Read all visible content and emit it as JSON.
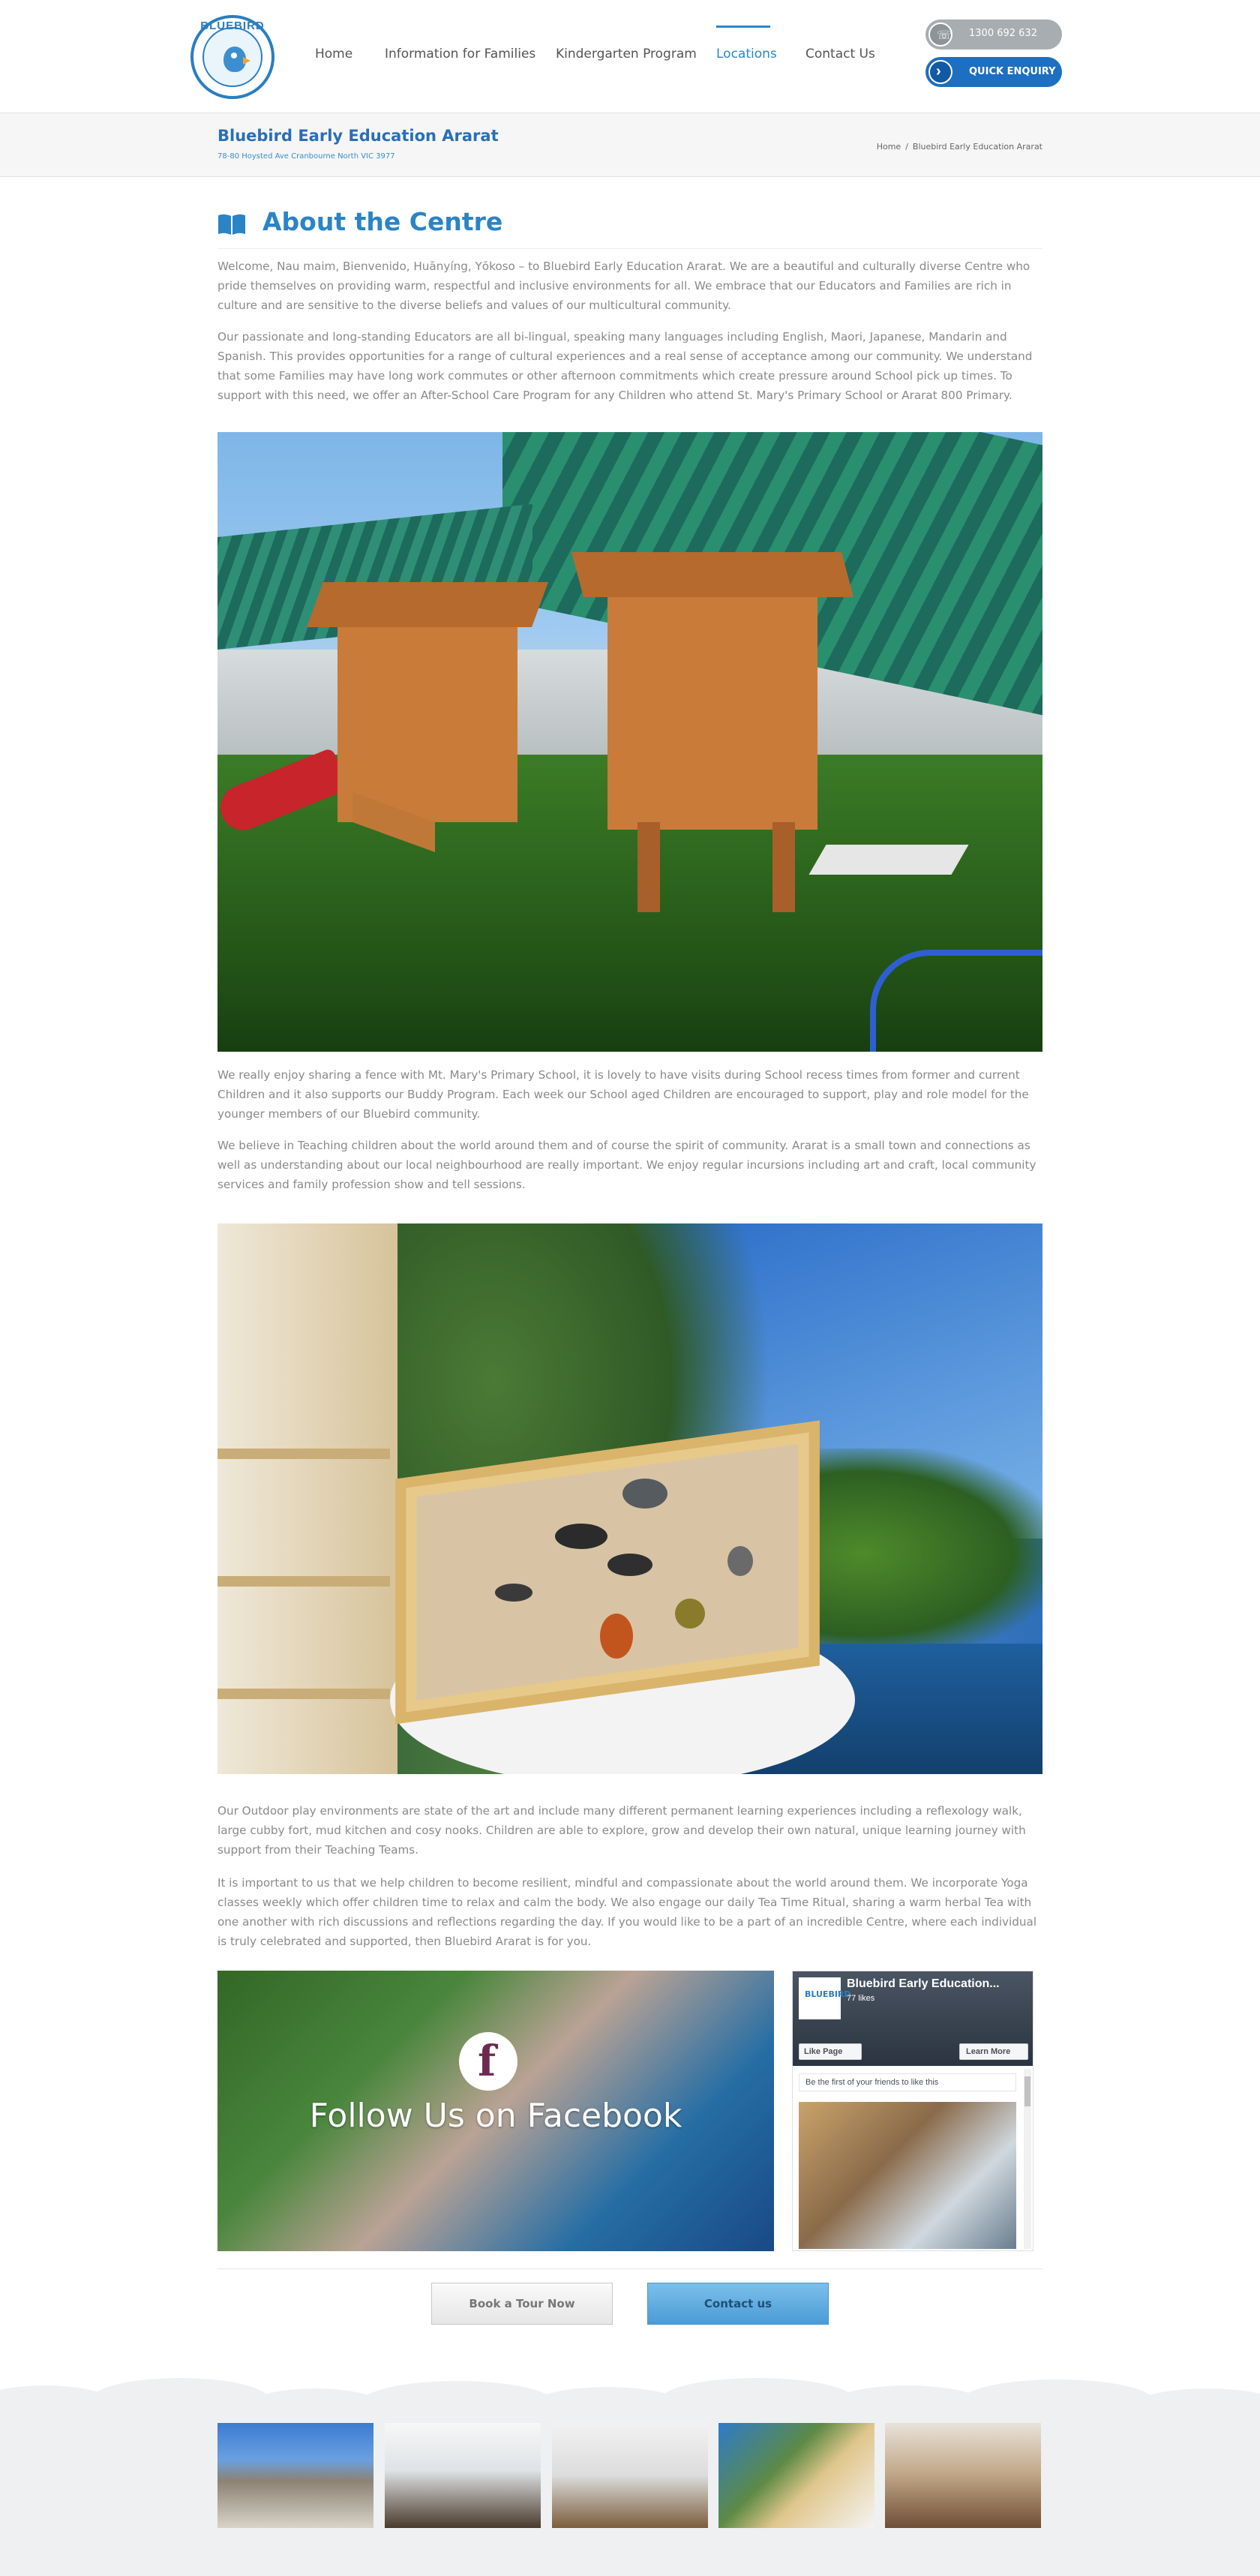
{
  "brand": {
    "logo_text": "BLUEBIRD",
    "primary_color": "#2a84c6",
    "accent_color": "#1d6fc1"
  },
  "nav": {
    "items": [
      {
        "label": "Home",
        "active": false
      },
      {
        "label": "Information for Families",
        "active": false
      },
      {
        "label": "Kindergarten Program",
        "active": false
      },
      {
        "label": "Locations",
        "active": true
      },
      {
        "label": "Contact Us",
        "active": false
      }
    ]
  },
  "header": {
    "phone": "1300 692 632",
    "quick_enquiry": "QUICK ENQUIRY",
    "phone_icon": "phone-icon",
    "enquiry_icon": "chevron-right-icon"
  },
  "titlebar": {
    "title": "Bluebird Early Education Ararat",
    "address": "78-80 Hoysted Ave Cranbourne North VIC 3977",
    "breadcrumb": [
      "Home",
      "Bluebird Early Education Ararat"
    ],
    "breadcrumb_sep": "/"
  },
  "about": {
    "heading": "About the Centre",
    "heading_icon": "book-icon",
    "paragraphs": [
      "Welcome, Nau maim, Bienvenido, Huānyíng, Yōkoso – to Bluebird Early Education Ararat. We are a beautiful and culturally diverse Centre who pride themselves on providing warm, respectful and inclusive environments for all. We embrace that our Educators and Families are rich in culture and are sensitive to the diverse beliefs and values of our multicultural community.",
      "Our passionate and long-standing Educators are all bi-lingual, speaking many languages including English, Maori, Japanese, Mandarin and Spanish. This provides opportunities for a range of cultural experiences and a real sense of acceptance among our community. We understand that some Families may have long work commutes or other afternoon commitments which create pressure around School pick up times. To support with this need, we offer an After-School Care Program for any Children who attend St. Mary's Primary School or Ararat 800 Primary.",
      "We really enjoy sharing a fence with Mt. Mary's Primary School, it is lovely to have visits during School recess times from former and current Children and it also supports our Buddy Program. Each week our School aged Children are encouraged to support, play and role model for the younger members of our Bluebird community.",
      "We believe in Teaching children about the world around them and of course the spirit of community. Ararat is a small town and connections as well as understanding about our local neighbourhood are really important. We enjoy regular incursions including art and craft, local community services and family profession show and tell sessions.",
      "Our Outdoor play environments are state of the art and include many different permanent learning experiences including a reflexology walk, large cubby fort, mud kitchen and cosy nooks. Children are able to explore, grow and develop their own natural, unique learning journey with support from their Teaching Teams.",
      "It is important to us that we help children to become resilient, mindful and compassionate about the world around them. We incorporate Yoga classes weekly which offer children time to relax and calm the body. We also engage our daily Tea Time Ritual, sharing a warm herbal Tea with one another with rich discussions and reflections regarding the day. If you would like to be a part of an incredible Centre, where each individual is truly celebrated and supported, then Bluebird Ararat is for you."
    ]
  },
  "facebook": {
    "banner_text": "Follow Us on Facebook",
    "banner_icon": "facebook-f-icon",
    "widget": {
      "page_name": "Bluebird Early Education...",
      "likes": "77 likes",
      "like_button": "Like Page",
      "learn_button": "Learn More",
      "first_friend": "Be the first of your friends to like this"
    }
  },
  "cta": {
    "tour": "Book a Tour Now",
    "contact": "Contact us"
  }
}
